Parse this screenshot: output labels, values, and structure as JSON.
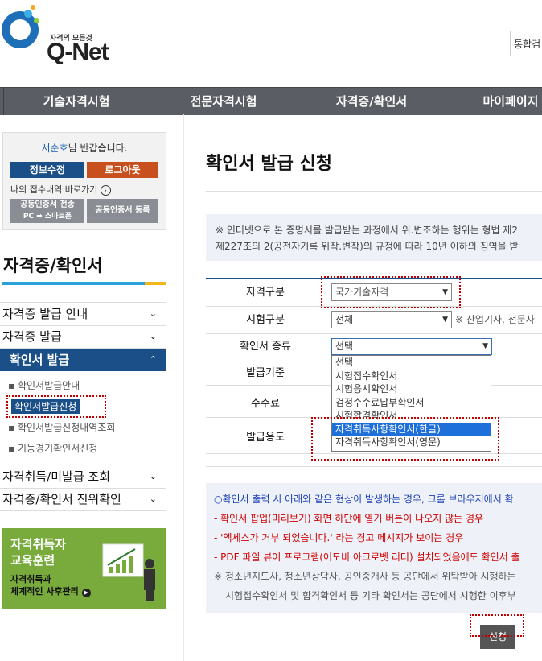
{
  "logo": {
    "tagline": "자격의 모든것",
    "name": "Q-Net"
  },
  "header": {
    "search_label": "통합검"
  },
  "nav": {
    "items": [
      "기술자격시험",
      "전문자격시험",
      "자격증/확인서",
      "마이페이지"
    ]
  },
  "login": {
    "user": "서순호",
    "greeting": "님 반갑습니다.",
    "edit_info": "정보수정",
    "logout": "로그아웃",
    "recent": "나의 접수내역 바로가기",
    "cert_transfer_line1": "공동인증서 전송",
    "cert_transfer_line2": "PC ➡ 스마트폰",
    "cert_register": "공동인증서 등록"
  },
  "sidebar": {
    "title": "자격증/확인서",
    "items": [
      {
        "label": "자격증 발급 안내"
      },
      {
        "label": "자격증 발급"
      },
      {
        "label": "확인서 발급"
      },
      {
        "label": "자격취득/미발급 조회"
      },
      {
        "label": "자격증/확인서 진위확인"
      }
    ],
    "sub_items": [
      "확인서발급안내",
      "확인서발급신청",
      "확인서발급신청내역조회",
      "기능경기확인서신청"
    ],
    "banner": {
      "title_line1": "자격취득자",
      "title_line2": "교육훈련",
      "sub_line1": "자격취득과",
      "sub_line2": "체계적인 사후관리"
    }
  },
  "main": {
    "title": "확인서 발급 신청",
    "notice_line1": "※ 인터넷으로 본 증명서를 발급받는 과정에서 위.변조하는 행위는 형법 제2",
    "notice_line2": "제227조의 2(공전자기록 위작.변작)의 규정에 따라 10년 이하의 징역을 받",
    "form": {
      "qual_type_label": "자격구분",
      "qual_type_value": "국가기술자격",
      "exam_type_label": "시험구분",
      "exam_type_value": "전체",
      "exam_type_note": "※ 산업기사, 전문사",
      "cert_kind_label": "확인서 종류",
      "cert_kind_value": "선택",
      "issue_basis_label": "발급기준",
      "fee_label": "수수료",
      "purpose_label": "발급용도",
      "cert_kind_options": [
        "선택",
        "시험접수확인서",
        "시험응시확인서",
        "검정수수료납부확인서",
        "시험합격확인서",
        "자격취득사항확인서(한글)",
        "자격취득사항확인서(영문)"
      ],
      "highlighted_option": "자격취득사항확인서(한글)"
    },
    "info": {
      "line1": "○확인서 출력 시 아래와 같은 현상이 발생하는 경우, 크롬 브라우저에서 확",
      "line2": "- 확인서 팝업(미리보기) 화면 하단에 열기 버튼이 나오지 않는 경우",
      "line3": "- '엑세스가 거부 되었습니다.' 라는 경고 메시지가 보이는 경우",
      "line4": "- PDF 파일 뷰어 프로그램(어도비 아크로벳 리더) 설치되었음에도 확인서 출",
      "line5": "※ 청소년지도사, 청소년상담사, 공인중개사 등 공단에서 위탁받아 시행하는",
      "line6": "시험접수확인서 및 합격확인서 등 기타 확인서는 공단에서 시행한 이후부"
    },
    "submit_label": "신청"
  },
  "colors": {
    "nav_bg": "#5a5d63",
    "primary": "#1b4f87",
    "logout": "#c8501e",
    "highlight": "#c00000",
    "banner": "#78ab3c"
  }
}
